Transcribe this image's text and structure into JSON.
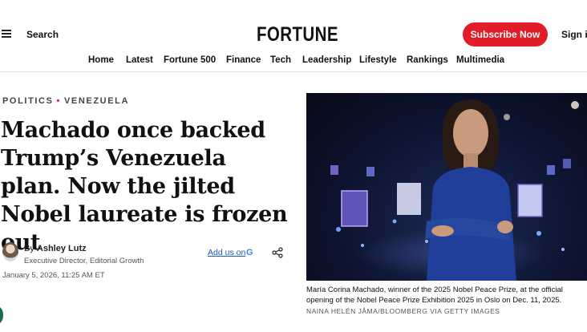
{
  "header": {
    "search_label": "Search",
    "logo_text": "FORTUNE",
    "subscribe_label": "Subscribe Now",
    "signin_label": "Sign in"
  },
  "nav": {
    "items": [
      "Home",
      "Latest",
      "Fortune 500",
      "Finance",
      "Tech",
      "Leadership",
      "Lifestyle",
      "Rankings",
      "Multimedia"
    ]
  },
  "article": {
    "category": "POLITICS",
    "subcategory": "VENEZUELA",
    "headline": "Machado once backed Trump’s Venezuela plan. Now the jilted Nobel laureate is frozen out",
    "byline_prefix": "By",
    "author": "Ashley Lutz",
    "author_role": "Executive Director, Editorial Growth",
    "add_us_label": "Add us on",
    "google_letter": "G",
    "date": "January 5, 2026, 11:25 AM ET"
  },
  "image": {
    "caption": "María Corina Machado, winner of the 2025 Nobel Peace Prize, at the official opening of the Nobel Peace Prize Exhibition 2025 in Oslo on Dec. 11, 2025.",
    "credit": "NAINA HELÉN JÅMA/BLOOMBERG VIA GETTY IMAGES"
  },
  "colors": {
    "accent": "#e11d2a",
    "link": "#1a58b8",
    "photo_dress": "#1f3f9a"
  }
}
